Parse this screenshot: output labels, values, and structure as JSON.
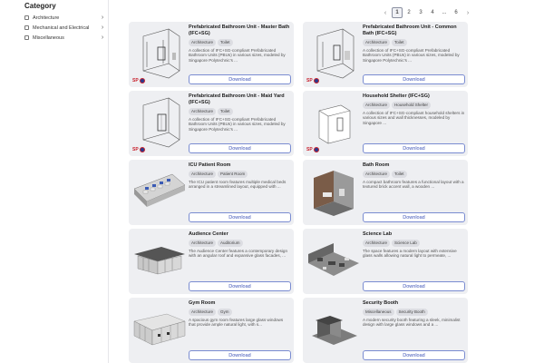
{
  "sidebar": {
    "title": "Category",
    "categories": [
      {
        "label": "Architecture"
      },
      {
        "label": "Mechanical and Electrical"
      },
      {
        "label": "Miscellaneous"
      }
    ]
  },
  "pagination": {
    "prev": "‹",
    "pages": [
      "1",
      "2",
      "3",
      "4",
      "...",
      "6"
    ],
    "active": "1",
    "next": "›"
  },
  "download_label": "Download",
  "logo_text": "SP",
  "cards": [
    {
      "title": "Prefabricated Bathroom Unit - Master Bath (IFC+SG)",
      "tags": [
        "Architecture",
        "Toilet"
      ],
      "description": "A collection of IFC+SG-compliant Prefabricated Bathroom Units (PBUs) in various sizes, modeled by Singapore Polytechnic's ...",
      "icon": "bathroom-unit"
    },
    {
      "title": "Prefabricated Bathroom Unit - Common Bath (IFC+SG)",
      "tags": [
        "Architecture",
        "Toilet"
      ],
      "description": "A collection of IFC+SG-compliant Prefabricated Bathroom Units (PBUs) in various sizes, modeled by Singapore Polytechnic's ...",
      "icon": "bathroom-unit"
    },
    {
      "title": "Prefabricated Bathroom Unit - Maid Yard (IFC+SG)",
      "tags": [
        "Architecture",
        "Toilet"
      ],
      "description": "A collection of IFC+SG-compliant Prefabricated Bathroom Units (PBUs) in various sizes, modeled by Singapore Polytechnic's ...",
      "icon": "bathroom-unit"
    },
    {
      "title": "Household Shelter (IFC+SG)",
      "tags": [
        "Architecture",
        "Household Shelter"
      ],
      "description": "A collection of IFC+SG-compliant household shelters in various sizes and wall thicknesses, modeled by Singapore ...",
      "icon": "shelter"
    },
    {
      "title": "ICU Patient Room",
      "tags": [
        "Architecture",
        "Patient Room"
      ],
      "description": "The ICU patient room features multiple medical beds arranged in a streamlined layout, equipped with ...",
      "icon": "icu-room"
    },
    {
      "title": "Bath Room",
      "tags": [
        "Architecture",
        "Toilet"
      ],
      "description": "A compact bathroom features a functional layout with a textured brick accent wall, a wooden ...",
      "icon": "bath-room"
    },
    {
      "title": "Audience Center",
      "tags": [
        "Architecture",
        "Auditorium"
      ],
      "description": "The Audience Center features a contemporary design with an angular roof and expansive glass facades, ...",
      "icon": "audience-center"
    },
    {
      "title": "Science Lab",
      "tags": [
        "Architecture",
        "Science Lab"
      ],
      "description": "The space features a modern layout with extensive glass walls allowing natural light to permeate, ...",
      "icon": "science-lab"
    },
    {
      "title": "Gym Room",
      "tags": [
        "Architecture",
        "Gym"
      ],
      "description": "A spacious gym room features large glass windows that provide ample natural light, with s...",
      "icon": "gym-room"
    },
    {
      "title": "Security Booth",
      "tags": [
        "Miscellaneous",
        "Security Booth"
      ],
      "description": "A modern security booth featuring a sleek, minimalist design with large glass windows and a ...",
      "icon": "security-booth"
    }
  ]
}
